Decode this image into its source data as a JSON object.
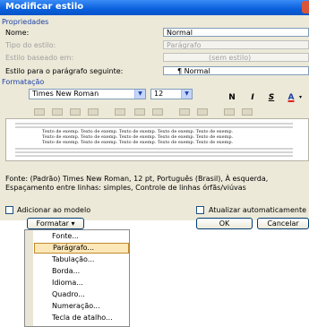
{
  "window": {
    "title": "Modificar estilo"
  },
  "properties": {
    "section_label": "Propriedades",
    "name_label": "Nome:",
    "name_value": "Normal",
    "type_label": "Tipo do estilo:",
    "type_value": "Parágrafo",
    "based_label": "Estilo baseado em:",
    "based_value": "(sem estilo)",
    "next_label": "Estilo para o parágrafo seguinte:",
    "next_value": "¶ Normal"
  },
  "formatting": {
    "section_label": "Formatação",
    "font": "Times New Roman",
    "size": "12",
    "bold": "N",
    "italic": "I",
    "underline": "S",
    "font_color": "A"
  },
  "preview": {
    "sample_lines": [
      "Texto de exemp. Texto de exemp. Texto de exemp. Texto de exemp. Texto de exemp.",
      "Texto de exemp. Texto de exemp. Texto de exemp. Texto de exemp. Texto de exemp.",
      "Texto de exemp. Texto de exemp. Texto de exemp. Texto de exemp. Texto de exemp."
    ]
  },
  "description": {
    "line1": "Fonte: (Padrão) Times New Roman, 12 pt, Português (Brasil), À esquerda,",
    "line2": "Espaçamento entre linhas: simples, Controle de linhas órfãs/viúvas"
  },
  "options": {
    "add_template": "Adicionar ao modelo",
    "auto_update": "Atualizar automaticamente"
  },
  "buttons": {
    "format": "Formatar ▾",
    "ok": "OK",
    "cancel": "Cancelar"
  },
  "format_menu": {
    "items": [
      "Fonte...",
      "Parágrafo...",
      "Tabulação...",
      "Borda...",
      "Idioma...",
      "Quadro...",
      "Numeração...",
      "Tecla de atalho..."
    ],
    "selected": "Parágrafo..."
  },
  "colors": {
    "titlebar": "#0a5fdc",
    "section_text": "#1c3fa6",
    "menu_highlight": "#fbe7b8",
    "font_color_bar": "#e02020"
  }
}
